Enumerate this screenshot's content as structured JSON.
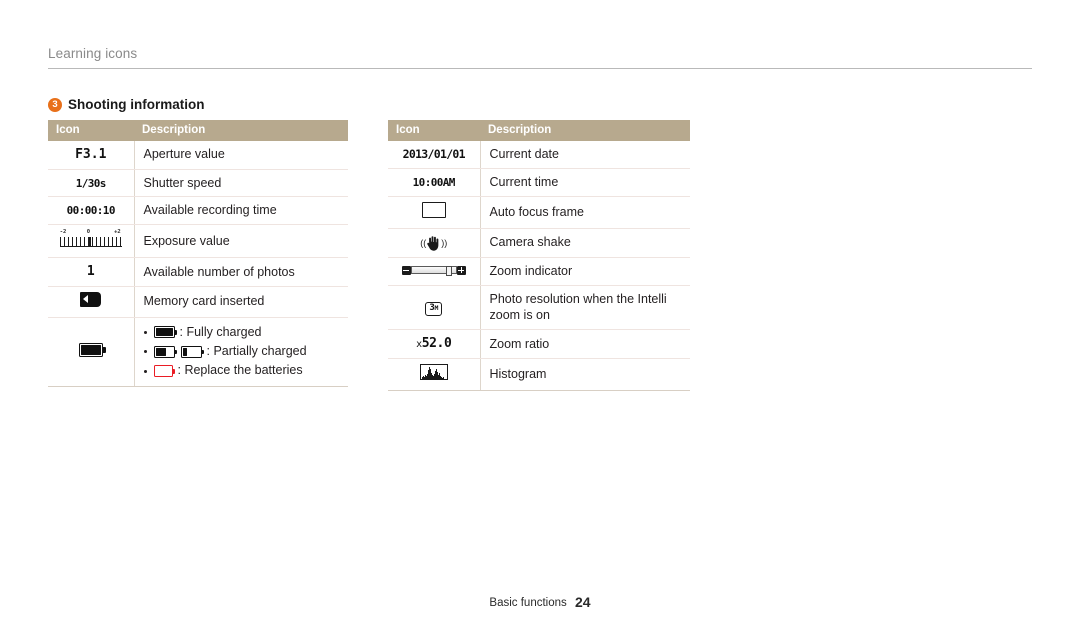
{
  "header": {
    "running_head": "Learning icons"
  },
  "section": {
    "number": "3",
    "title": "Shooting information",
    "badge_color": "#e8701a"
  },
  "tables": {
    "header_bg": "#b7a98e",
    "left": {
      "columns": [
        "Icon",
        "Description"
      ],
      "rows": [
        {
          "icon_name": "aperture-value-icon",
          "icon_text": "F3.1",
          "description": "Aperture value"
        },
        {
          "icon_name": "shutter-speed-icon",
          "icon_text": "1/30s",
          "description": "Shutter speed"
        },
        {
          "icon_name": "recording-time-icon",
          "icon_text": "00:00:10",
          "description": "Available recording time"
        },
        {
          "icon_name": "exposure-value-icon",
          "icon_text": "",
          "ev_labels": [
            "-2",
            "0",
            "+2"
          ],
          "description": "Exposure value"
        },
        {
          "icon_name": "photo-count-icon",
          "icon_text": "1",
          "description": "Available number of photos"
        },
        {
          "icon_name": "memory-card-icon",
          "icon_text": "",
          "description": "Memory card inserted"
        },
        {
          "icon_name": "battery-icon",
          "icon_text": "",
          "description": "",
          "bullets": [
            "Fully charged",
            "Partially charged",
            "Replace the batteries"
          ]
        }
      ]
    },
    "right": {
      "columns": [
        "Icon",
        "Description"
      ],
      "rows": [
        {
          "icon_name": "current-date-icon",
          "icon_text": "2013/01/01",
          "description": "Current date"
        },
        {
          "icon_name": "current-time-icon",
          "icon_text": "10:00AM",
          "description": "Current time"
        },
        {
          "icon_name": "auto-focus-frame-icon",
          "icon_text": "",
          "description": "Auto focus frame"
        },
        {
          "icon_name": "camera-shake-icon",
          "icon_text": "",
          "description": "Camera shake"
        },
        {
          "icon_name": "zoom-indicator-icon",
          "icon_text": "",
          "description": "Zoom indicator"
        },
        {
          "icon_name": "photo-resolution-icon",
          "icon_text": "3M",
          "description": "Photo resolution when the Intelli zoom is on"
        },
        {
          "icon_name": "zoom-ratio-icon",
          "icon_text": "52.0",
          "icon_prefix": "x",
          "description": "Zoom ratio"
        },
        {
          "icon_name": "histogram-icon",
          "icon_text": "",
          "description": "Histogram"
        }
      ]
    }
  },
  "footer": {
    "chapter": "Basic functions",
    "page_number": "24"
  }
}
